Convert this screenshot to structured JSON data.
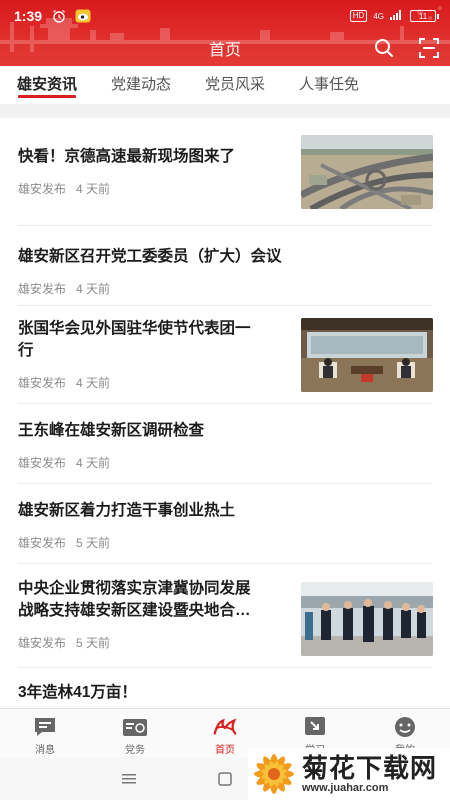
{
  "status_bar": {
    "time": "1:39",
    "hd": "HD",
    "network": "4G",
    "battery": "11"
  },
  "header": {
    "title": "首页",
    "search_icon": "search-icon",
    "scan_icon": "scan-icon"
  },
  "tabs": [
    {
      "label": "雄安资讯",
      "active": true
    },
    {
      "label": "党建动态",
      "active": false
    },
    {
      "label": "党员风采",
      "active": false
    },
    {
      "label": "人事任免",
      "active": false
    }
  ],
  "news": [
    {
      "title": "快看！京德高速最新现场图来了",
      "source": "雄安发布",
      "time": "4 天前",
      "has_image": true,
      "image": "highway-aerial"
    },
    {
      "title": "雄安新区召开党工委委员（扩大）会议",
      "source": "雄安发布",
      "time": "4 天前",
      "has_image": false
    },
    {
      "title_line1": "张国华会见外国驻华使节代表团一",
      "title_line2": "行",
      "source": "雄安发布",
      "time": "4 天前",
      "has_image": true,
      "image": "meeting-room"
    },
    {
      "title": "王东峰在雄安新区调研检查",
      "source": "雄安发布",
      "time": "4 天前",
      "has_image": false
    },
    {
      "title": "雄安新区着力打造干事创业热土",
      "source": "雄安发布",
      "time": "5 天前",
      "has_image": false
    },
    {
      "title_line1": "中央企业贯彻落实京津冀协同发展",
      "title_line2": "战略支持雄安新区建设暨央地合…",
      "source": "雄安发布",
      "time": "5 天前",
      "has_image": true,
      "image": "officials-walking"
    },
    {
      "title": "3年造林41万亩！",
      "has_image": false
    }
  ],
  "bottom_nav": [
    {
      "label": "消息",
      "icon": "message-icon",
      "active": false
    },
    {
      "label": "党务",
      "icon": "party-affairs-icon",
      "active": false
    },
    {
      "label": "首页",
      "icon": "home-logo-icon",
      "active": true
    },
    {
      "label": "学习",
      "icon": "study-icon",
      "active": false
    },
    {
      "label": "我的",
      "icon": "profile-face-icon",
      "active": false
    }
  ],
  "watermark": {
    "name": "菊花下载网",
    "url": "www.juahar.com"
  },
  "colors": {
    "primary": "#d9191c",
    "active_tab": "#d91e1e",
    "text": "#1c1c1c",
    "meta": "#8c8c8c"
  }
}
